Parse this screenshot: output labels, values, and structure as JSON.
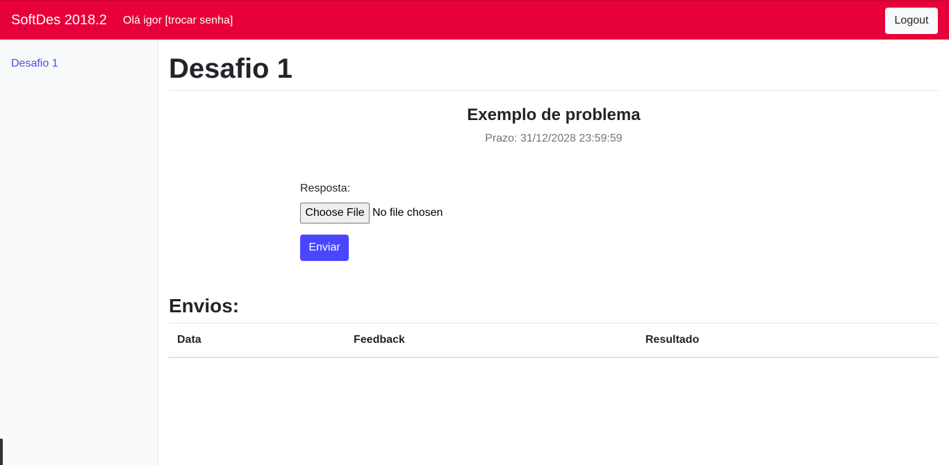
{
  "navbar": {
    "brand": "SoftDes 2018.2",
    "greeting": "Olá igor",
    "change_password": "[trocar senha]",
    "logout": "Logout",
    "color": "#e8003a"
  },
  "sidebar": {
    "items": [
      {
        "label": "Desafio 1"
      }
    ]
  },
  "main": {
    "title": "Desafio 1",
    "problem_title": "Exemplo de problema",
    "deadline": "Prazo: 31/12/2028 23:59:59",
    "form": {
      "label": "Resposta:",
      "file_button": "Choose File",
      "file_status": "No file chosen",
      "submit": "Enviar"
    },
    "submissions": {
      "title": "Envios:",
      "columns": [
        "Data",
        "Feedback",
        "Resultado"
      ],
      "rows": []
    }
  },
  "colors": {
    "accent": "#4a46ff",
    "link": "#4a4cf0",
    "muted": "#6c757d"
  }
}
